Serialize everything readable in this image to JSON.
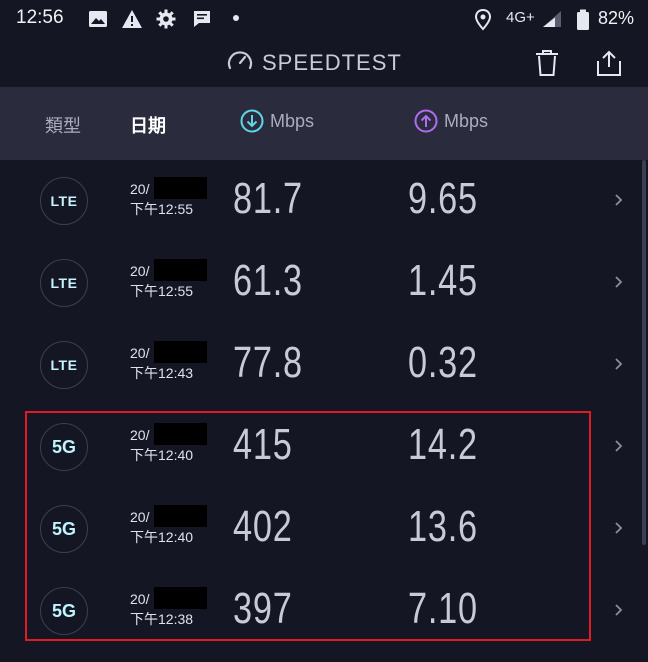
{
  "status_bar": {
    "time": "12:56",
    "network": "4G+",
    "battery": "82%"
  },
  "app_bar": {
    "title": "SPEEDTEST"
  },
  "header": {
    "type_label": "類型",
    "date_label": "日期",
    "download_unit": "Mbps",
    "upload_unit": "Mbps"
  },
  "results": [
    {
      "type": "LTE",
      "date": "20/",
      "time": "下午12:55",
      "download": "81.7",
      "upload": "9.65"
    },
    {
      "type": "LTE",
      "date": "20/",
      "time": "下午12:55",
      "download": "61.3",
      "upload": "1.45"
    },
    {
      "type": "LTE",
      "date": "20/",
      "time": "下午12:43",
      "download": "77.8",
      "upload": "0.32"
    },
    {
      "type": "5G",
      "date": "20/",
      "time": "下午12:40",
      "download": "415",
      "upload": "14.2"
    },
    {
      "type": "5G",
      "date": "20/",
      "time": "下午12:40",
      "download": "402",
      "upload": "13.6"
    },
    {
      "type": "5G",
      "date": "20/",
      "time": "下午12:38",
      "download": "397",
      "upload": "7.10"
    }
  ],
  "colors": {
    "background": "#151624",
    "header_background": "#2a2c3d",
    "download_accent": "#5fd6e8",
    "upload_accent": "#b06cf0",
    "highlight": "#e01b24"
  }
}
